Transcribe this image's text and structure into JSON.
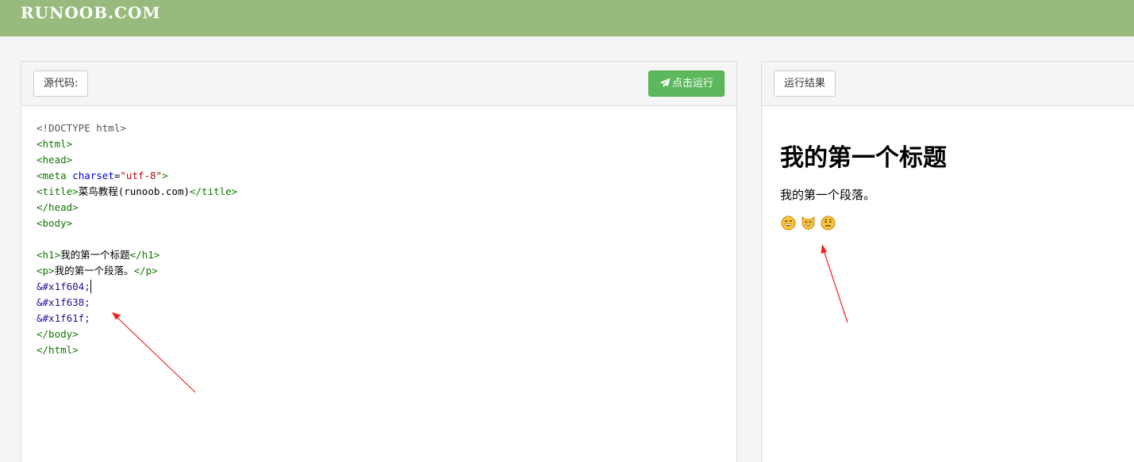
{
  "header": {
    "logo": "RUNOOB.COM"
  },
  "source_panel": {
    "tab_label": "源代码:",
    "run_label": "点击运行",
    "code_lines": [
      "<!DOCTYPE html>",
      "<html>",
      "<head>",
      "<meta",
      "charset",
      "\"utf-8\"",
      "<title>",
      "菜鸟教程(runoob.com)",
      "</title>",
      "</head>",
      "<body>",
      "<h1>",
      "我的第一个标题",
      "</h1>",
      "<p>",
      "我的第一个段落。",
      "</p>",
      "&#x1f604;",
      "&#x1f638;",
      "&#x1f61f;",
      "</body>",
      "</html>"
    ]
  },
  "result_panel": {
    "tab_label": "运行结果",
    "heading": "我的第一个标题",
    "paragraph": "我的第一个段落。",
    "emojis": [
      "grinning-face-icon",
      "grinning-cat-icon",
      "worried-face-icon"
    ]
  },
  "colors": {
    "header_bg": "#96bb7c",
    "run_button": "#5cb85c",
    "annotation_arrow": "#ee2222"
  }
}
